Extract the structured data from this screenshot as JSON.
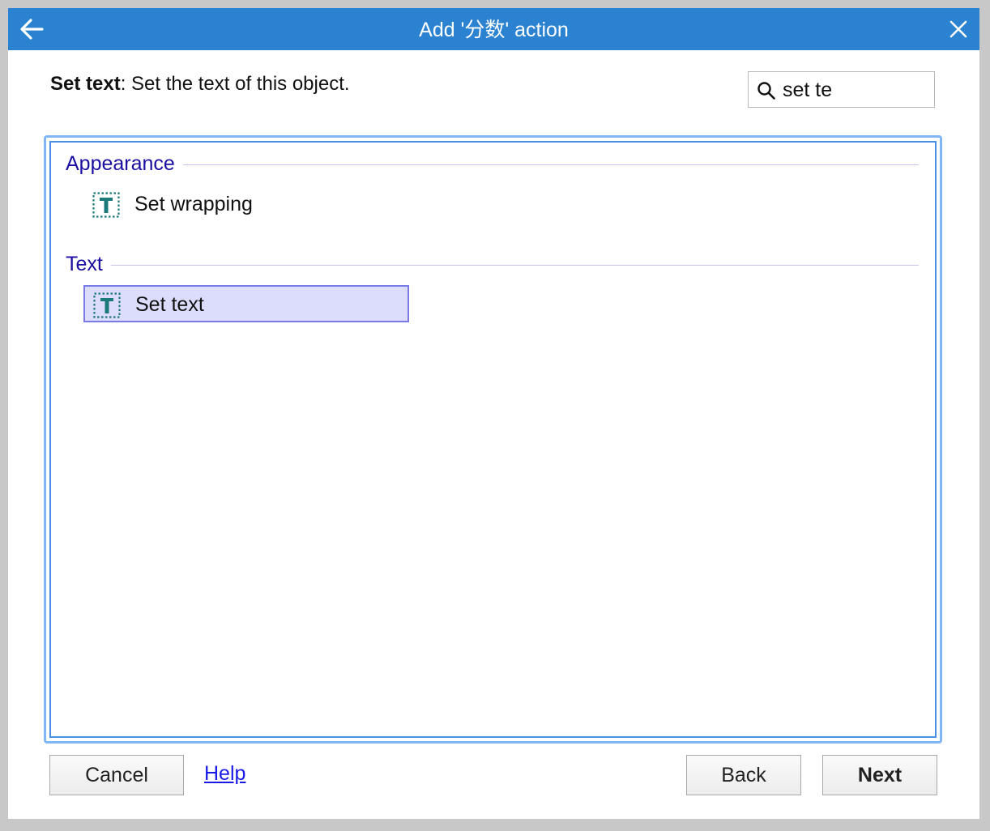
{
  "window": {
    "title": "Add '分数' action"
  },
  "description": {
    "action_name": "Set text",
    "text": ": Set the text of this object."
  },
  "search": {
    "value": "set te"
  },
  "groups": [
    {
      "label": "Appearance",
      "items": [
        {
          "label": "Set wrapping",
          "icon": "text-object-icon",
          "selected": false
        }
      ]
    },
    {
      "label": "Text",
      "items": [
        {
          "label": "Set text",
          "icon": "text-object-icon",
          "selected": true
        }
      ]
    }
  ],
  "buttons": {
    "cancel": "Cancel",
    "help": "Help",
    "back": "Back",
    "next": "Next"
  },
  "colors": {
    "titlebar": "#2a82d0",
    "group_label": "#1a0fa0",
    "selection_bg": "#dcdcfc",
    "selection_border": "#7a7ae8",
    "icon_teal": "#1d7a7a"
  }
}
